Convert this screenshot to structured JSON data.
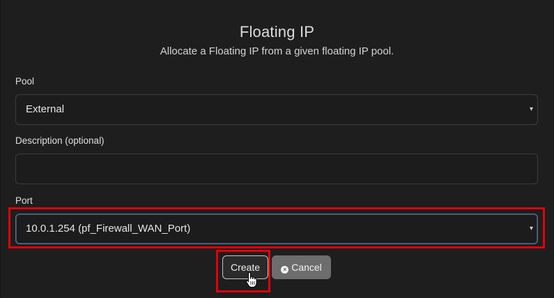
{
  "dialog": {
    "title": "Floating IP",
    "subtitle": "Allocate a Floating IP from a given floating IP pool."
  },
  "fields": {
    "pool": {
      "label": "Pool",
      "value": "External"
    },
    "description": {
      "label": "Description (optional)",
      "value": "",
      "placeholder": ""
    },
    "port": {
      "label": "Port",
      "value": "10.0.1.254 (pf_Firewall_WAN_Port)"
    }
  },
  "buttons": {
    "create_label": "Create",
    "cancel_label": "Cancel"
  },
  "icons": {
    "caret": "▾",
    "cancel": "×"
  },
  "colors": {
    "background": "#1e1e1e",
    "highlight": "#e0000e",
    "cancel_button": "#6d6d6d"
  }
}
